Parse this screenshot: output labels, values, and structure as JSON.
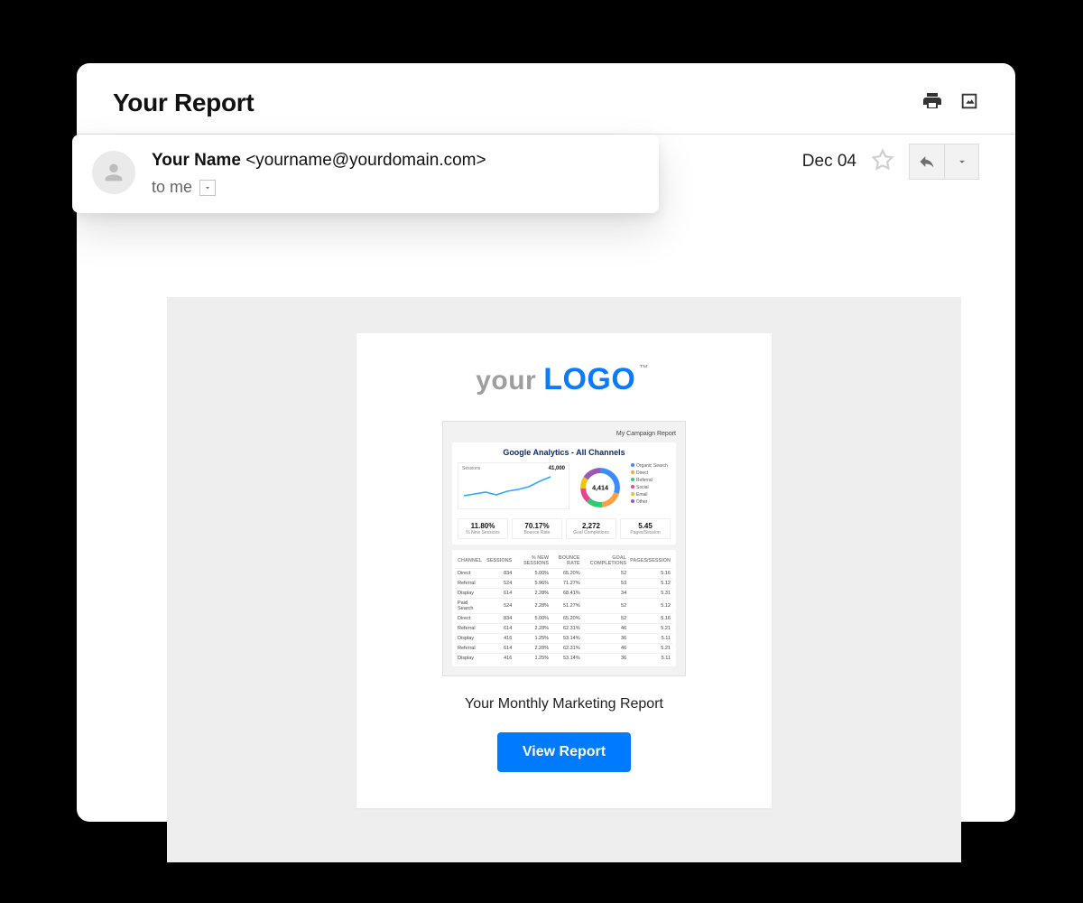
{
  "subject": "Your Report",
  "sender": {
    "name": "Your Name",
    "email": "<yourname@yourdomain.com>",
    "recipient_label": "to me"
  },
  "date": "Dec 04",
  "logo": {
    "part1": "your",
    "part2": "LOGO",
    "tm": "™"
  },
  "preview": {
    "small_title": "My Campaign Report",
    "section_title": "Google Analytics - All Channels",
    "chart_label": "Sessions",
    "chart_value": "41,000",
    "donut_value": "4,414",
    "metrics": [
      {
        "value": "11.80%",
        "label": "% New Sessions"
      },
      {
        "value": "70.17%",
        "label": "Bounce Rate"
      },
      {
        "value": "2,272",
        "label": "Goal Completions"
      },
      {
        "value": "5.45",
        "label": "Pages/Session"
      }
    ],
    "table": {
      "headers": [
        "CHANNEL",
        "SESSIONS",
        "% NEW SESSIONS",
        "BOUNCE RATE",
        "GOAL COMPLETIONS",
        "PAGES/SESSION"
      ],
      "rows": [
        [
          "Direct",
          "834",
          "5.00%",
          "65.20%",
          "52",
          "5.16"
        ],
        [
          "Referral",
          "524",
          "5.96%",
          "71.27%",
          "53",
          "5.12"
        ],
        [
          "Display",
          "614",
          "2.28%",
          "68.41%",
          "34",
          "5.31"
        ],
        [
          "Paid Search",
          "524",
          "2.28%",
          "51.27%",
          "52",
          "5.12"
        ],
        [
          "Direct",
          "834",
          "5.00%",
          "65.20%",
          "52",
          "5.16"
        ],
        [
          "Referral",
          "614",
          "2.28%",
          "62.31%",
          "46",
          "5.21"
        ],
        [
          "Display",
          "416",
          "1.25%",
          "53.14%",
          "36",
          "5.11"
        ],
        [
          "Referral",
          "614",
          "2.28%",
          "62.31%",
          "46",
          "5.21"
        ],
        [
          "Display",
          "416",
          "1.25%",
          "53.14%",
          "36",
          "5.11"
        ]
      ]
    }
  },
  "caption": "Your Monthly Marketing Report",
  "cta": "View Report"
}
